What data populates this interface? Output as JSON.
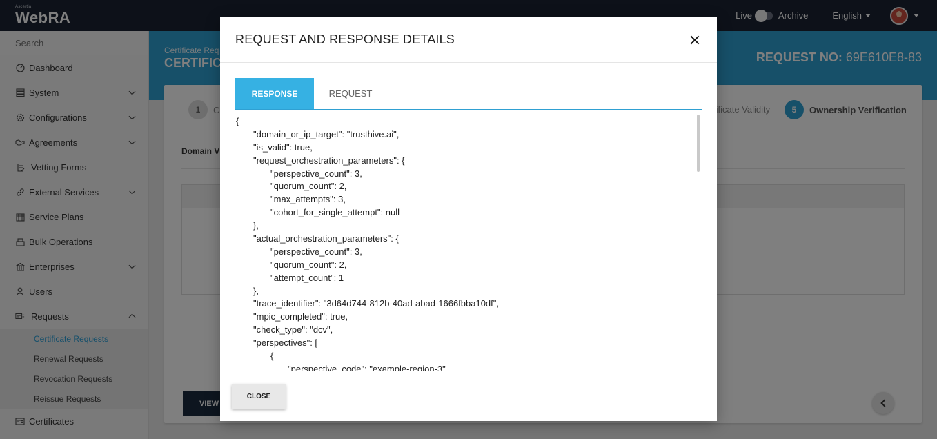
{
  "app": {
    "brand_small": "Ascertia",
    "brand_name": "WebRA",
    "live_label": "Live",
    "archive_label": "Archive",
    "language": "English"
  },
  "sidebar": {
    "search_placeholder": "Search",
    "items": [
      {
        "label": "Dashboard",
        "icon": "dashboard-icon",
        "expandable": false
      },
      {
        "label": "System",
        "icon": "system-icon",
        "expandable": true
      },
      {
        "label": "Configurations",
        "icon": "gear-icon",
        "expandable": true
      },
      {
        "label": "Agreements",
        "icon": "handshake-icon",
        "expandable": true
      },
      {
        "label": "Vetting Forms",
        "icon": "form-icon",
        "expandable": false
      },
      {
        "label": "External Services",
        "icon": "link-icon",
        "expandable": true
      },
      {
        "label": "Service Plans",
        "icon": "plans-icon",
        "expandable": false
      },
      {
        "label": "Bulk Operations",
        "icon": "bulk-icon",
        "expandable": false
      },
      {
        "label": "Enterprises",
        "icon": "building-icon",
        "expandable": true
      },
      {
        "label": "Users",
        "icon": "user-icon",
        "expandable": false
      },
      {
        "label": "Requests",
        "icon": "requests-icon",
        "expandable": true
      }
    ],
    "request_subitems": [
      "Certificate Requests",
      "Renewal Requests",
      "Revocation Requests",
      "Reissue Requests"
    ],
    "last_item": "Certificates"
  },
  "page": {
    "breadcrumb": "Certificate Req",
    "title": "CERTIFICA",
    "request_no_label": "REQUEST NO:",
    "request_no_value": "69E610E8-83",
    "steps": {
      "step1_num": "1",
      "step1_label": "C",
      "step4_label": "tificate Validity",
      "step5_num": "5",
      "step5_label": "Ownership Verification"
    },
    "section_label": "Domain V",
    "view_button": "VIEW C"
  },
  "modal": {
    "title": "REQUEST AND RESPONSE DETAILS",
    "tabs": [
      "RESPONSE",
      "REQUEST"
    ],
    "close_button": "CLOSE",
    "lines": [
      "{",
      "\"domain_or_ip_target\": \"trusthive.ai\",",
      "\"is_valid\": true,",
      "\"request_orchestration_parameters\": {",
      "\"perspective_count\": 3,",
      "\"quorum_count\": 2,",
      "\"max_attempts\": 3,",
      "\"cohort_for_single_attempt\": null",
      "},",
      "\"actual_orchestration_parameters\": {",
      "\"perspective_count\": 3,",
      "\"quorum_count\": 2,",
      "\"attempt_count\": 1",
      "},",
      "\"trace_identifier\": \"3d64d744-812b-40ad-abad-1666fbba10df\",",
      "\"mpic_completed\": true,",
      "\"check_type\": \"dcv\",",
      "\"perspectives\": [",
      "{",
      "\"perspective_code\": \"example-region-3\","
    ]
  }
}
